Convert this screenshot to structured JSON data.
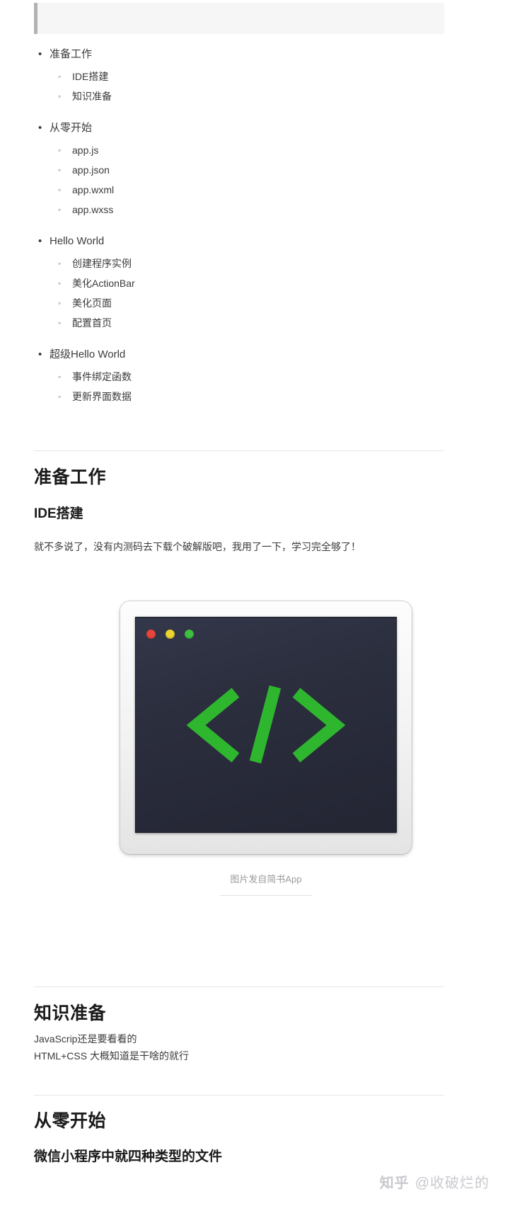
{
  "blockquote": {
    "text": ""
  },
  "toc": {
    "groups": [
      {
        "label": "准备工作",
        "marker": "•",
        "children": [
          {
            "label": "IDE搭建",
            "marker": "◦"
          },
          {
            "label": "知识准备",
            "marker": "◦"
          }
        ]
      },
      {
        "label": "从零开始",
        "marker": "•",
        "children": [
          {
            "label": "app.js",
            "marker": "◦"
          },
          {
            "label": "app.json",
            "marker": "◦"
          },
          {
            "label": "app.wxml",
            "marker": "◦"
          },
          {
            "label": "app.wxss",
            "marker": "◦"
          }
        ]
      },
      {
        "label": "Hello World",
        "marker": "•",
        "children": [
          {
            "label": "创建程序实例",
            "marker": "◦"
          },
          {
            "label": "美化ActionBar",
            "marker": "◦"
          },
          {
            "label": "美化页面",
            "marker": "◦"
          },
          {
            "label": "配置首页",
            "marker": "◦"
          }
        ]
      },
      {
        "label": "超级Hello World",
        "marker": "•",
        "children": [
          {
            "label": "事件绑定函数",
            "marker": "◦"
          },
          {
            "label": "更新界面数据",
            "marker": "◦"
          }
        ]
      }
    ]
  },
  "sections": {
    "prep_heading": "准备工作",
    "ide_heading": "IDE搭建",
    "ide_paragraph": "就不多说了，没有内测码去下载个破解版吧，我用了一下，学习完全够了！",
    "knowledge_heading": "知识准备",
    "knowledge_line1": "JavaScrip还是要看看的",
    "knowledge_line2": "HTML+CSS 大概知道是干啥的就行",
    "start_heading": "从零开始",
    "filetypes_heading": "微信小程序中就四种类型的文件"
  },
  "figure": {
    "caption": "图片发自简书App",
    "screen_color": "#2b2e3d",
    "glyph_color": "#2fb62f",
    "frame_color": "#f2f2f2",
    "dots": [
      {
        "name": "close",
        "color": "#e8453c"
      },
      {
        "name": "minimize",
        "color": "#ecd42f"
      },
      {
        "name": "maximize",
        "color": "#3fbf3f"
      }
    ],
    "glyph": "</>"
  },
  "watermark": {
    "logo": "知乎",
    "handle": "@收破烂的"
  }
}
